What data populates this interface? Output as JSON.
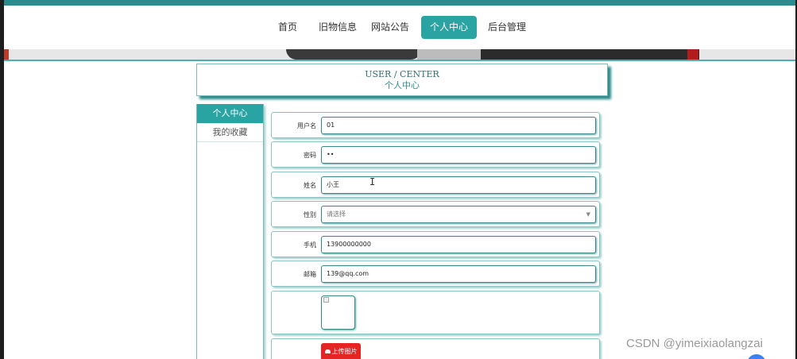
{
  "nav": {
    "items": [
      {
        "label": "首页"
      },
      {
        "label": "旧物信息"
      },
      {
        "label": "网站公告"
      },
      {
        "label": "个人中心",
        "active": true
      },
      {
        "label": "后台管理"
      }
    ]
  },
  "header": {
    "title_en": "USER / CENTER",
    "title_cn": "个人中心"
  },
  "sidebar": {
    "items": [
      {
        "label": "个人中心",
        "active": true
      },
      {
        "label": "我的收藏"
      }
    ]
  },
  "form": {
    "username": {
      "label": "用户名",
      "value": "01"
    },
    "password": {
      "label": "密码",
      "value": "••"
    },
    "name": {
      "label": "姓名",
      "value": "小王"
    },
    "gender": {
      "label": "性别",
      "placeholder": "请选择"
    },
    "phone": {
      "label": "手机",
      "value": "13900000000"
    },
    "email": {
      "label": "邮箱",
      "value": "139@qq.com"
    },
    "upload_label": "上传图片"
  },
  "watermark": "CSDN @yimeixiaolangzai",
  "colors": {
    "accent": "#2aa3a3",
    "upload": "#e52424"
  }
}
